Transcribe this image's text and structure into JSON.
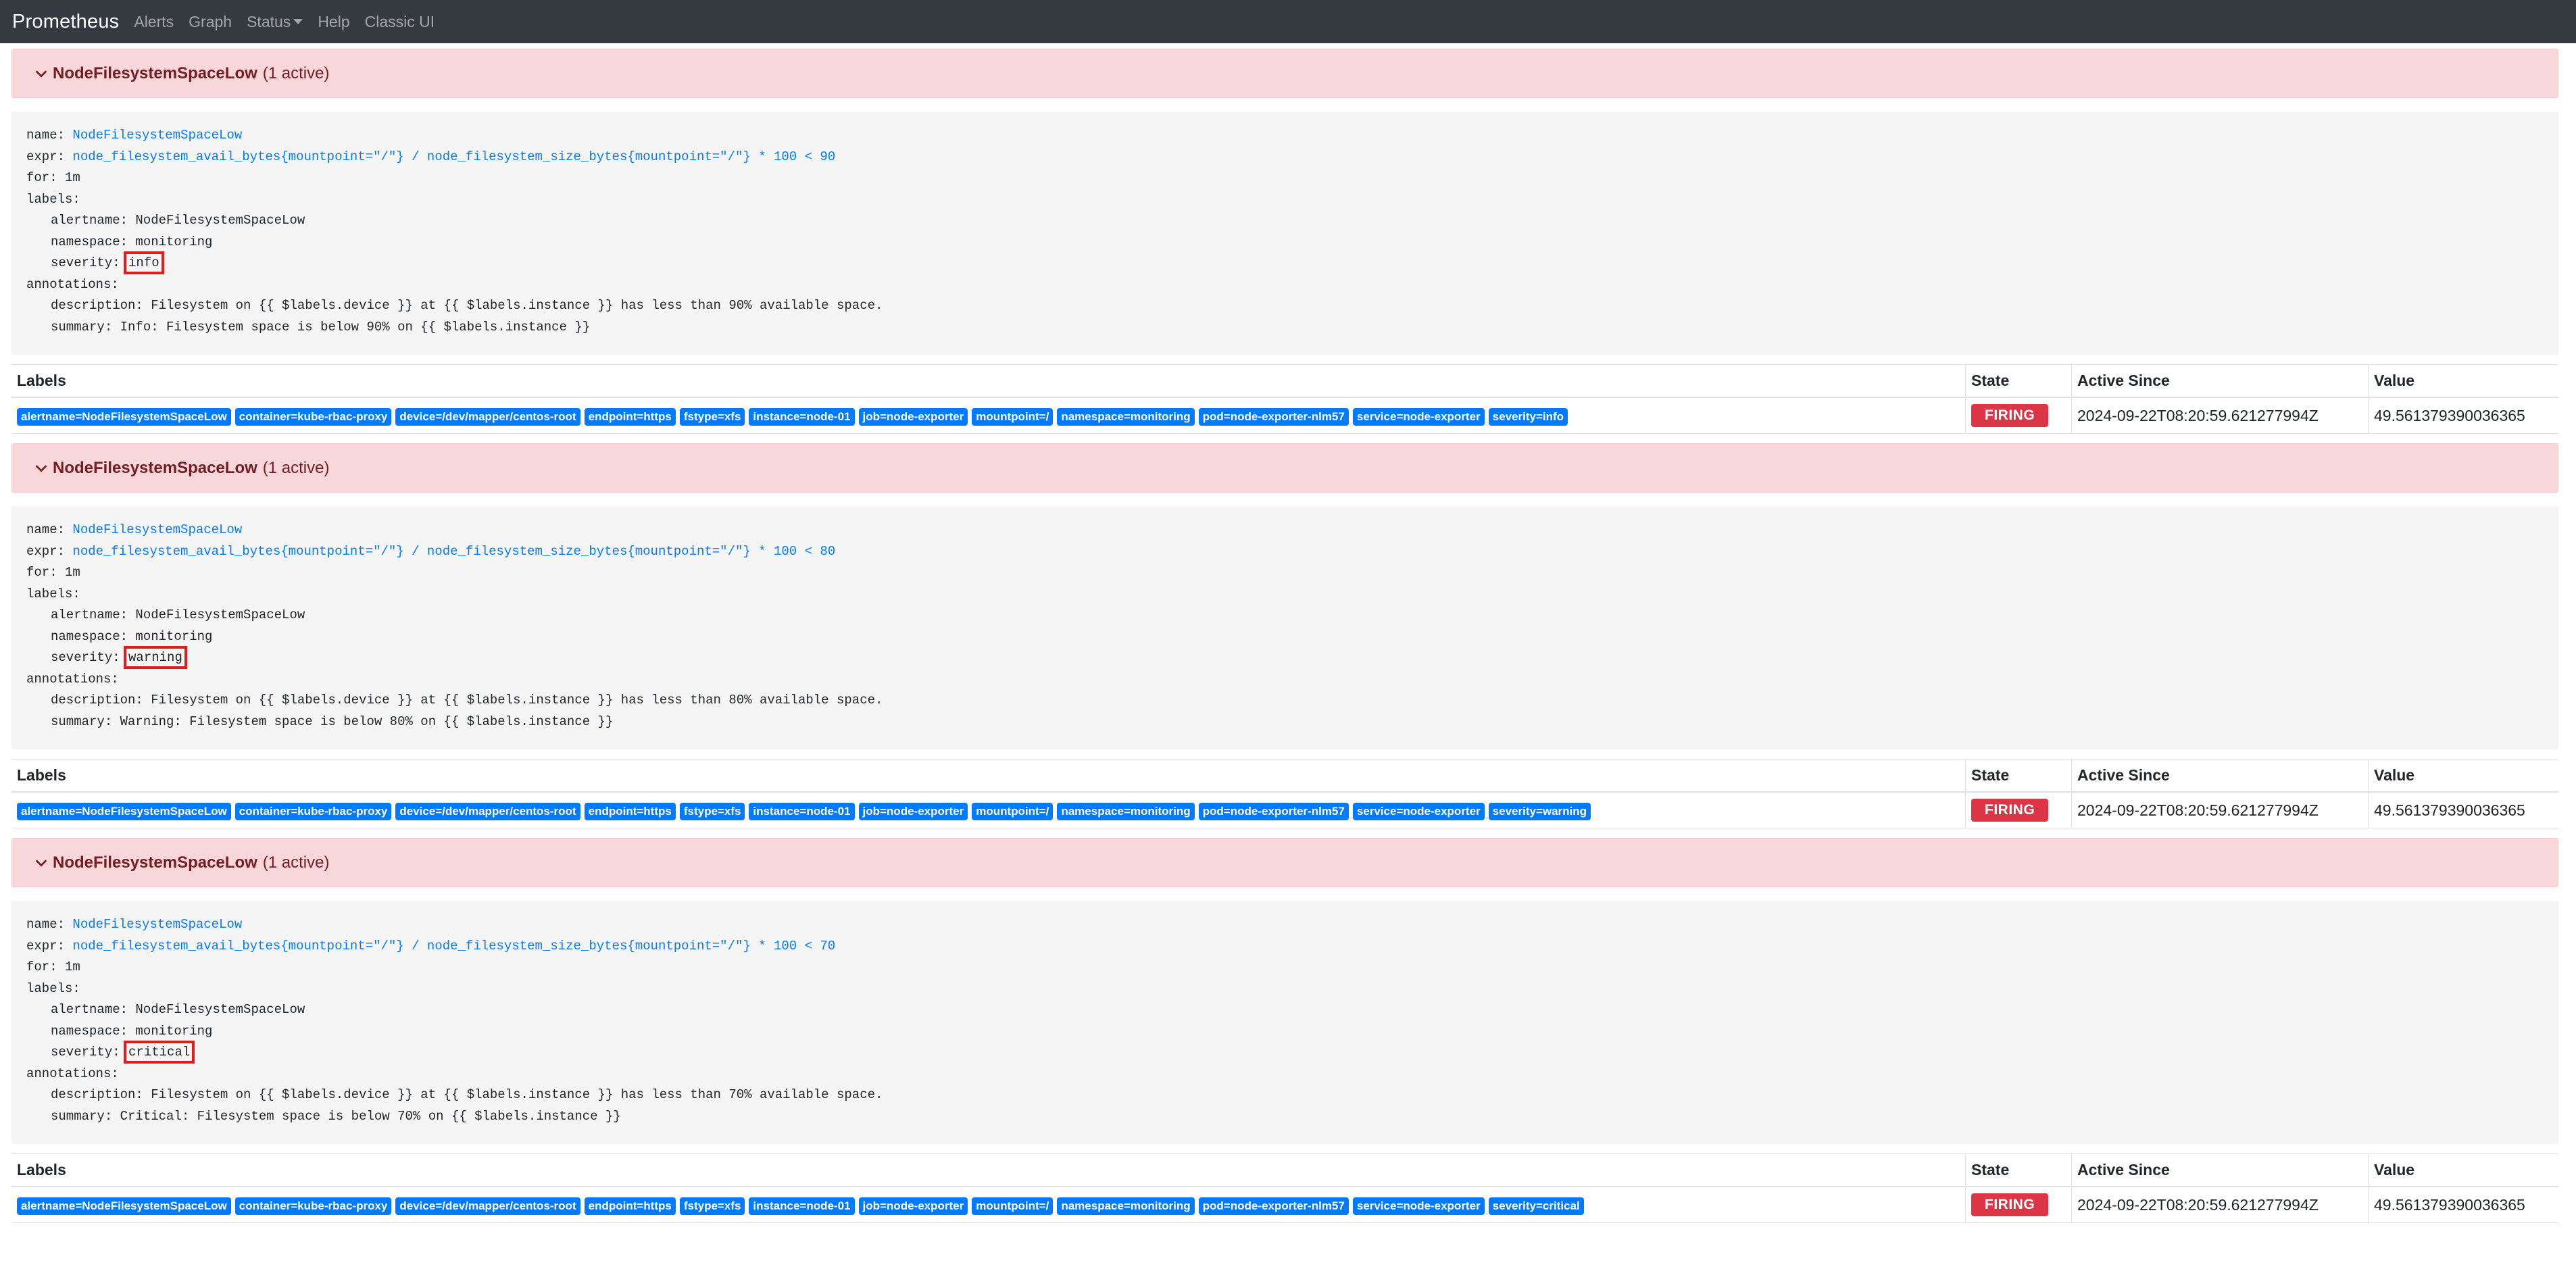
{
  "nav": {
    "brand": "Prometheus",
    "items": [
      "Alerts",
      "Graph",
      "Status",
      "Help",
      "Classic UI"
    ]
  },
  "colors": {
    "navbar": "#343a40",
    "group_header_bg": "#f8d7da",
    "label_badge": "#007bff",
    "firing_badge": "#dc3545",
    "highlight_box": "#e21b1b"
  },
  "table_headers": {
    "labels": "Labels",
    "state": "State",
    "active_since": "Active Since",
    "value": "Value"
  },
  "rule_keys": {
    "name": "name:",
    "expr": "expr:",
    "for": "for: 1m",
    "labels": "labels:",
    "alertname": "alertname: NodeFilesystemSpaceLow",
    "namespace": "namespace: monitoring",
    "severity": "severity:",
    "annotations": "annotations:"
  },
  "groups": [
    {
      "header_name": "NodeFilesystemSpaceLow",
      "header_count": "(1 active)",
      "name": "NodeFilesystemSpaceLow",
      "expr": "node_filesystem_avail_bytes{mountpoint=\"/\"} / node_filesystem_size_bytes{mountpoint=\"/\"} * 100 < 90",
      "severity": "info",
      "description": "description: Filesystem on {{ $labels.device }} at {{ $labels.instance }} has less than 90% available space.",
      "summary": "summary: Info: Filesystem space is below 90% on {{ $labels.instance }}",
      "labels": [
        "alertname=NodeFilesystemSpaceLow",
        "container=kube-rbac-proxy",
        "device=/dev/mapper/centos-root",
        "endpoint=https",
        "fstype=xfs",
        "instance=node-01",
        "job=node-exporter",
        "mountpoint=/",
        "namespace=monitoring",
        "pod=node-exporter-nlm57",
        "service=node-exporter",
        "severity=info"
      ],
      "state": "FIRING",
      "active_since": "2024-09-22T08:20:59.621277994Z",
      "value": "49.561379390036365"
    },
    {
      "header_name": "NodeFilesystemSpaceLow",
      "header_count": "(1 active)",
      "name": "NodeFilesystemSpaceLow",
      "expr": "node_filesystem_avail_bytes{mountpoint=\"/\"} / node_filesystem_size_bytes{mountpoint=\"/\"} * 100 < 80",
      "severity": "warning",
      "description": "description: Filesystem on {{ $labels.device }} at {{ $labels.instance }} has less than 80% available space.",
      "summary": "summary: Warning: Filesystem space is below 80% on {{ $labels.instance }}",
      "labels": [
        "alertname=NodeFilesystemSpaceLow",
        "container=kube-rbac-proxy",
        "device=/dev/mapper/centos-root",
        "endpoint=https",
        "fstype=xfs",
        "instance=node-01",
        "job=node-exporter",
        "mountpoint=/",
        "namespace=monitoring",
        "pod=node-exporter-nlm57",
        "service=node-exporter",
        "severity=warning"
      ],
      "state": "FIRING",
      "active_since": "2024-09-22T08:20:59.621277994Z",
      "value": "49.561379390036365"
    },
    {
      "header_name": "NodeFilesystemSpaceLow",
      "header_count": "(1 active)",
      "name": "NodeFilesystemSpaceLow",
      "expr": "node_filesystem_avail_bytes{mountpoint=\"/\"} / node_filesystem_size_bytes{mountpoint=\"/\"} * 100 < 70",
      "severity": "critical",
      "description": "description: Filesystem on {{ $labels.device }} at {{ $labels.instance }} has less than 70% available space.",
      "summary": "summary: Critical: Filesystem space is below 70% on {{ $labels.instance }}",
      "labels": [
        "alertname=NodeFilesystemSpaceLow",
        "container=kube-rbac-proxy",
        "device=/dev/mapper/centos-root",
        "endpoint=https",
        "fstype=xfs",
        "instance=node-01",
        "job=node-exporter",
        "mountpoint=/",
        "namespace=monitoring",
        "pod=node-exporter-nlm57",
        "service=node-exporter",
        "severity=critical"
      ],
      "state": "FIRING",
      "active_since": "2024-09-22T08:20:59.621277994Z",
      "value": "49.561379390036365"
    }
  ]
}
